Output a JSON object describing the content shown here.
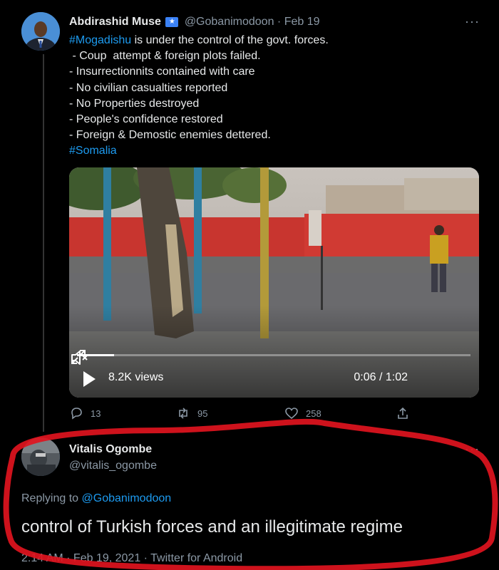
{
  "tweet": {
    "author_name": "Abdirashid Muse",
    "verified_icon": "★",
    "handle": "@Gobanimodoon",
    "separator": "·",
    "date": "Feb 19",
    "more": "···",
    "line1_hashtag": "#Mogadishu",
    "line1_rest": " is under the control of the govt. forces.",
    "lines": [
      " - Coup  attempt & foreign plots failed.",
      "- Insurrectionnits contained with care",
      "- No civilian casualties reported",
      "- No Properties destroyed",
      "- People's confidence restored",
      "- Foreign & Demostic enemies dettered."
    ],
    "last_hashtag": "#Somalia",
    "video": {
      "views": "8.2K views",
      "time": "0:06 / 1:02",
      "progress": 0.095
    },
    "actions": {
      "replies": "13",
      "retweets": "95",
      "likes": "258"
    }
  },
  "reply": {
    "author_name": "Vitalis Ogombe",
    "handle": "@vitalis_ogombe",
    "more": "···",
    "replying_prefix": "Replying to ",
    "replying_to": "@Gobanimodoon",
    "text": "control of Turkish forces and an illegitimate regime",
    "meta": "2:14 AM · Feb 19, 2021 · Twitter for Android"
  },
  "colors": {
    "accent": "#1d9bf0",
    "annotation": "#e0141e"
  }
}
